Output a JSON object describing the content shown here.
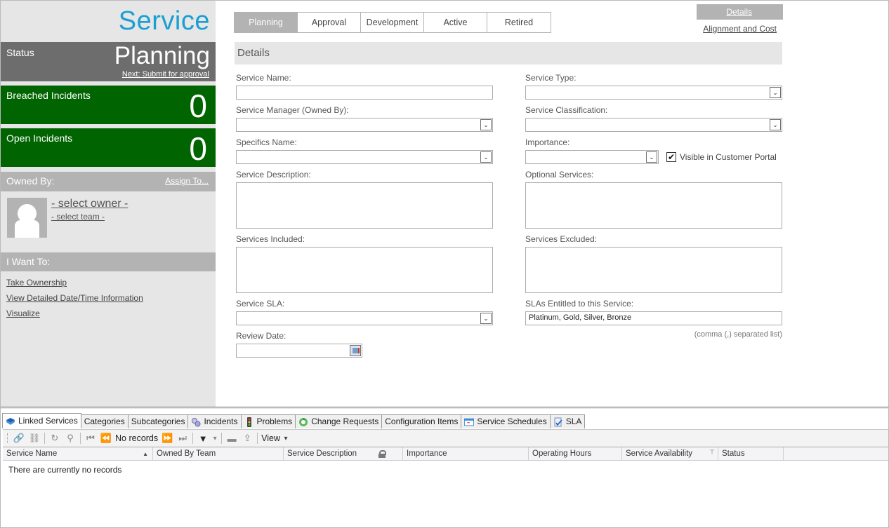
{
  "app": {
    "title": "Service"
  },
  "status": {
    "label": "Status",
    "value": "Planning",
    "next_action": "Next: Submit for approval"
  },
  "metrics": [
    {
      "label": "Breached Incidents",
      "value": "0",
      "color": "#006400"
    },
    {
      "label": "Open Incidents",
      "value": "0",
      "color": "#006400"
    }
  ],
  "owned_by": {
    "label": "Owned By:",
    "assign_link": "Assign To...",
    "owner": "- select owner -",
    "team": "- select team -"
  },
  "i_want_to": {
    "label": "I Want To:",
    "links": [
      "Take Ownership",
      "View Detailed Date/Time Information",
      "Visualize"
    ]
  },
  "lifecycle_tabs": [
    {
      "label": "Planning",
      "active": true
    },
    {
      "label": "Approval",
      "active": false
    },
    {
      "label": "Development",
      "active": false
    },
    {
      "label": "Active",
      "active": false
    },
    {
      "label": "Retired",
      "active": false
    }
  ],
  "side_nav": {
    "details": "Details",
    "alignment": "Alignment and Cost"
  },
  "section": {
    "title": "Details"
  },
  "form": {
    "service_name": {
      "label": "Service Name:",
      "value": ""
    },
    "service_type": {
      "label": "Service Type:",
      "value": ""
    },
    "service_manager": {
      "label": "Service Manager (Owned By):",
      "value": ""
    },
    "service_classification": {
      "label": "Service Classification:",
      "value": ""
    },
    "specifics_name": {
      "label": "Specifics Name:",
      "value": ""
    },
    "importance": {
      "label": "Importance:",
      "value": ""
    },
    "visible_portal": {
      "label": "Visible in Customer Portal",
      "checked": true,
      "glyph": "✔"
    },
    "service_description": {
      "label": "Service Description:",
      "value": ""
    },
    "optional_services": {
      "label": "Optional Services:",
      "value": ""
    },
    "services_included": {
      "label": "Services Included:",
      "value": ""
    },
    "services_excluded": {
      "label": "Services Excluded:",
      "value": ""
    },
    "service_sla": {
      "label": "Service SLA:",
      "value": ""
    },
    "slas_entitled": {
      "label": "SLAs Entitled to this Service:",
      "value": "Platinum, Gold, Silver, Bronze",
      "hint": "(comma (,) separated list)"
    },
    "review_date": {
      "label": "Review Date:",
      "value": ""
    },
    "dropdown_glyph": "⌄"
  },
  "bottom_tabs": [
    {
      "label": "Linked Services",
      "icon": "book-icon",
      "active": true
    },
    {
      "label": "Categories",
      "icon": "",
      "active": false
    },
    {
      "label": "Subcategories",
      "icon": "",
      "active": false
    },
    {
      "label": "Incidents",
      "icon": "incident-icon",
      "active": false
    },
    {
      "label": "Problems",
      "icon": "traffic-light-icon",
      "active": false
    },
    {
      "label": "Change Requests",
      "icon": "recycle-icon",
      "active": false
    },
    {
      "label": "Configuration Items",
      "icon": "",
      "active": false
    },
    {
      "label": "Service Schedules",
      "icon": "calendar-window-icon",
      "active": false
    },
    {
      "label": "SLA",
      "icon": "document-check-icon",
      "active": false
    }
  ],
  "toolbar": {
    "icons": {
      "link": "🔗",
      "unlink": "⛓",
      "refresh": "↻",
      "find": "⚲",
      "first": "⏮",
      "prev": "⏪",
      "next": "⏩",
      "last": "⏭",
      "filter": "▼",
      "dropdown": "▾",
      "print": "▬",
      "export": "⇪"
    },
    "records_text": "No records",
    "view_label": "View"
  },
  "grid": {
    "columns": [
      {
        "label": "Service Name",
        "sorted": true
      },
      {
        "label": "Owned By Team"
      },
      {
        "label": "Service Description",
        "locked": true
      },
      {
        "label": "Importance"
      },
      {
        "label": "Operating Hours"
      },
      {
        "label": "Service Availability",
        "filtered": true
      },
      {
        "label": "Status"
      },
      {
        "label": ""
      }
    ],
    "empty_text": "There are currently no records",
    "sort_glyph": "▲",
    "filter_glyph": "⊤"
  }
}
